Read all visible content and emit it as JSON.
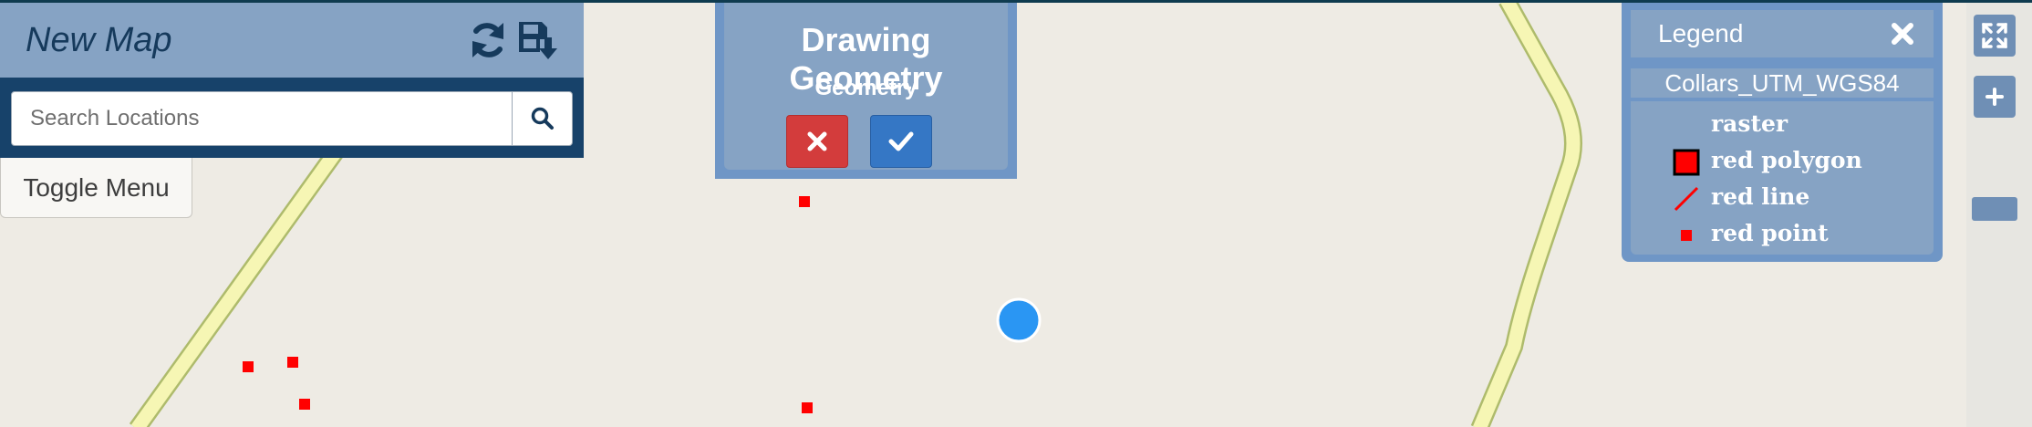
{
  "map": {
    "title": "New Map",
    "search": {
      "placeholder": "Search Locations",
      "value": ""
    },
    "toggle_menu_label": "Toggle Menu",
    "refresh_icon": "refresh-icon",
    "save_icon": "save-download-icon"
  },
  "drawing": {
    "title": "Drawing Geometry",
    "subtitle": "Geometry",
    "cancel_icon": "times-icon",
    "confirm_icon": "check-icon"
  },
  "legend": {
    "title": "Legend",
    "layer_name": "Collars_UTM_WGS84",
    "items": [
      {
        "label": "raster",
        "symbol": "none"
      },
      {
        "label": "red polygon",
        "symbol": "polygon",
        "color": "#ff0000"
      },
      {
        "label": "red line",
        "symbol": "line",
        "color": "#ff0000"
      },
      {
        "label": "red point",
        "symbol": "point",
        "color": "#ff0000"
      }
    ]
  },
  "controls": {
    "fullscreen_icon": "expand-icon",
    "zoom_in_icon": "plus-icon"
  },
  "colors": {
    "panel_header": "#86a3c4",
    "panel_dark": "#17426a",
    "legend_bg": "#6f96c6",
    "cancel": "#d33c3c",
    "confirm": "#3577c5",
    "road_fill": "#f6f6b4",
    "road_edge": "#aebb6c",
    "feature": "#ff0000",
    "location_marker": "#2a96f3",
    "map_bg": "#eeebe4"
  }
}
